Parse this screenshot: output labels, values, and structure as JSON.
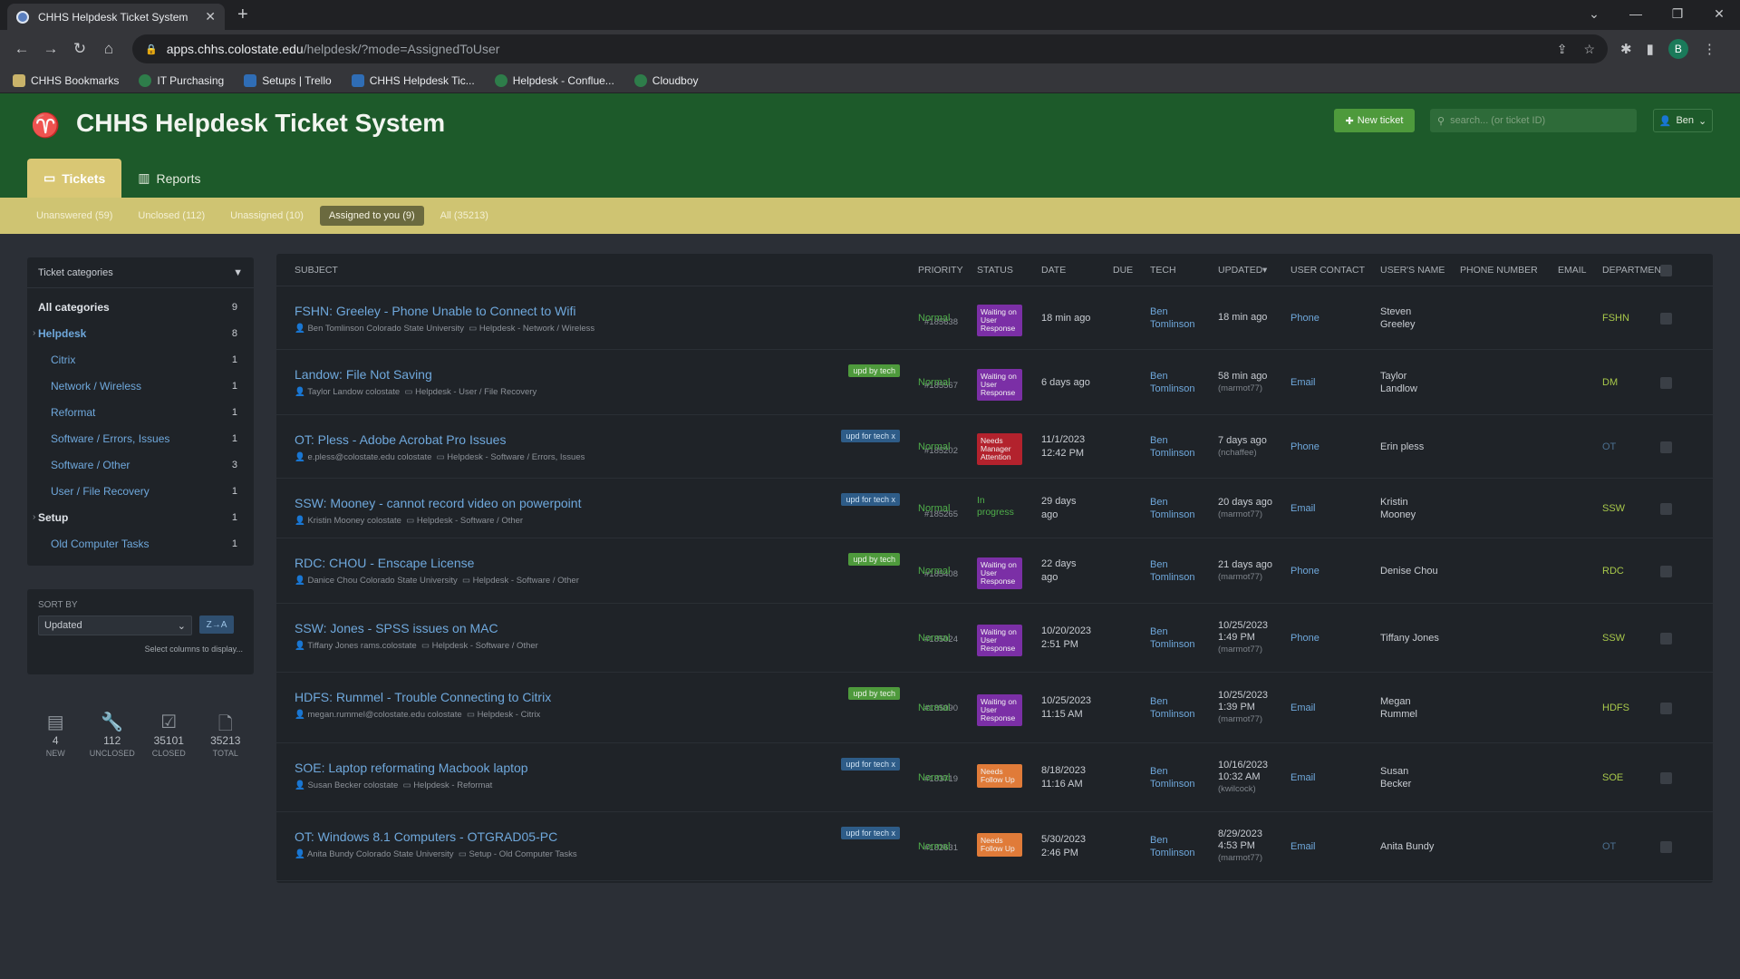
{
  "browser": {
    "tab_title": "CHHS Helpdesk Ticket System",
    "url_host": "apps.chhs.colostate.edu",
    "url_path": "/helpdesk/?mode=AssignedToUser",
    "profile_initial": "B",
    "bookmarks": [
      "CHHS Bookmarks",
      "IT Purchasing",
      "Setups | Trello",
      "CHHS Helpdesk Tic...",
      "Helpdesk - Conflue...",
      "Cloudboy"
    ]
  },
  "header": {
    "title": "CHHS Helpdesk Ticket System",
    "new_ticket": "New ticket",
    "search_placeholder": "search... (or ticket ID)",
    "user": "Ben"
  },
  "nav": {
    "tickets": "Tickets",
    "reports": "Reports"
  },
  "subnav": [
    "Unanswered (59)",
    "Unclosed (112)",
    "Unassigned (10)",
    "Assigned to you (9)",
    "All (35213)"
  ],
  "sidebar": {
    "categories_title": "Ticket categories",
    "categories": [
      {
        "name": "All categories",
        "count": "9"
      },
      {
        "name": "Helpdesk",
        "count": "8"
      },
      {
        "name": "Citrix",
        "count": "1"
      },
      {
        "name": "Network / Wireless",
        "count": "1"
      },
      {
        "name": "Reformat",
        "count": "1"
      },
      {
        "name": "Software / Errors, Issues",
        "count": "1"
      },
      {
        "name": "Software / Other",
        "count": "3"
      },
      {
        "name": "User / File Recovery",
        "count": "1"
      },
      {
        "name": "Setup",
        "count": "1"
      },
      {
        "name": "Old Computer Tasks",
        "count": "1"
      }
    ],
    "sort_label": "SORT BY",
    "sort_value": "Updated",
    "sort_dir": "Z→A",
    "select_columns": "Select columns to display...",
    "stats": [
      {
        "value": "4",
        "label": "NEW"
      },
      {
        "value": "112",
        "label": "UNCLOSED"
      },
      {
        "value": "35101",
        "label": "CLOSED"
      },
      {
        "value": "35213",
        "label": "TOTAL"
      }
    ]
  },
  "table": {
    "headers": [
      "SUBJECT",
      "PRIORITY",
      "STATUS",
      "DATE",
      "DUE",
      "TECH",
      "UPDATED",
      "USER CONTACT",
      "USER'S NAME",
      "PHONE NUMBER",
      "EMAIL",
      "DEPARTMENT"
    ],
    "rows": [
      {
        "subject": "FSHN: Greeley - Phone Unable to Connect to Wifi",
        "user": "Ben Tomlinson Colorado State University",
        "category": "Helpdesk - Network / Wireless",
        "badge": "",
        "number": "#185638",
        "priority": "Normal",
        "status": "Waiting on User Response",
        "date1": "18 min ago",
        "date2": "",
        "tech1": "Ben",
        "tech2": "Tomlinson",
        "upd1": "18 min ago",
        "upd2": "",
        "upd3": "",
        "contact": "Phone",
        "uname1": "Steven",
        "uname2": "Greeley",
        "dept": "FSHN"
      },
      {
        "subject": "Landow: File Not Saving",
        "user": "Taylor Landow colostate",
        "category": "Helpdesk - User / File Recovery",
        "badge": "upd by tech",
        "number": "#185567",
        "priority": "Normal",
        "status": "Waiting on User Response",
        "date1": "6 days ago",
        "date2": "",
        "tech1": "Ben",
        "tech2": "Tomlinson",
        "upd1": "58 min ago",
        "upd2": "",
        "upd3": "(marmot77)",
        "contact": "Email",
        "uname1": "Taylor",
        "uname2": "Landlow",
        "dept": "DM"
      },
      {
        "subject": "OT: Pless - Adobe Acrobat Pro Issues",
        "user": "e.pless@colostate.edu colostate",
        "category": "Helpdesk - Software / Errors, Issues",
        "badge": "upd for tech x",
        "number": "#185202",
        "priority": "Normal",
        "status": "Needs Manager Attention",
        "date1": "11/1/2023",
        "date2": "12:42 PM",
        "tech1": "Ben",
        "tech2": "Tomlinson",
        "upd1": "7 days ago",
        "upd2": "",
        "upd3": "(nchaffee)",
        "contact": "Phone",
        "uname1": "Erin pless",
        "uname2": "",
        "dept": "OT"
      },
      {
        "subject": "SSW: Mooney - cannot record video on powerpoint",
        "user": "Kristin Mooney colostate",
        "category": "Helpdesk - Software / Other",
        "badge": "upd for tech x",
        "number": "#185265",
        "priority": "Normal",
        "status": "In progress",
        "date1": "29 days",
        "date2": "ago",
        "tech1": "Ben",
        "tech2": "Tomlinson",
        "upd1": "20 days ago",
        "upd2": "",
        "upd3": "(marmot77)",
        "contact": "Email",
        "uname1": "Kristin",
        "uname2": "Mooney",
        "dept": "SSW"
      },
      {
        "subject": "RDC: CHOU - Enscape License",
        "user": "Danice Chou Colorado State University",
        "category": "Helpdesk - Software / Other",
        "badge": "upd by tech",
        "number": "#185408",
        "priority": "Normal",
        "status": "Waiting on User Response",
        "date1": "22 days",
        "date2": "ago",
        "tech1": "Ben",
        "tech2": "Tomlinson",
        "upd1": "21 days ago",
        "upd2": "",
        "upd3": "(marmot77)",
        "contact": "Phone",
        "uname1": "Denise Chou",
        "uname2": "",
        "dept": "RDC"
      },
      {
        "subject": "SSW: Jones - SPSS issues on MAC",
        "user": "Tiffany Jones rams.colostate",
        "category": "Helpdesk - Software / Other",
        "badge": "",
        "number": "#185024",
        "priority": "Normal",
        "status": "Waiting on User Response",
        "date1": "10/20/2023",
        "date2": "2:51 PM",
        "tech1": "Ben",
        "tech2": "Tomlinson",
        "upd1": "10/25/2023",
        "upd2": "1:49 PM",
        "upd3": "(marmot77)",
        "contact": "Phone",
        "uname1": "Tiffany Jones",
        "uname2": "",
        "dept": "SSW"
      },
      {
        "subject": "HDFS: Rummel - Trouble Connecting to Citrix",
        "user": "megan.rummel@colostate.edu colostate",
        "category": "Helpdesk - Citrix",
        "badge": "upd by tech",
        "number": "#185090",
        "priority": "Normal",
        "status": "Waiting on User Response",
        "date1": "10/25/2023",
        "date2": "11:15 AM",
        "tech1": "Ben",
        "tech2": "Tomlinson",
        "upd1": "10/25/2023",
        "upd2": "1:39 PM",
        "upd3": "(marmot77)",
        "contact": "Email",
        "uname1": "Megan",
        "uname2": "Rummel",
        "dept": "HDFS"
      },
      {
        "subject": "SOE: Laptop reformating Macbook laptop",
        "user": "Susan Becker colostate",
        "category": "Helpdesk - Reformat",
        "badge": "upd for tech x",
        "number": "#183719",
        "priority": "Normal",
        "status": "Needs Follow Up",
        "date1": "8/18/2023",
        "date2": "11:16 AM",
        "tech1": "Ben",
        "tech2": "Tomlinson",
        "upd1": "10/16/2023",
        "upd2": "10:32 AM",
        "upd3": "(kwilcock)",
        "contact": "Email",
        "uname1": "Susan",
        "uname2": "Becker",
        "dept": "SOE"
      },
      {
        "subject": "OT: Windows 8.1 Computers - OTGRAD05-PC",
        "user": "Anita Bundy Colorado State University",
        "category": "Setup - Old Computer Tasks",
        "badge": "upd for tech x",
        "number": "#182631",
        "priority": "Normal",
        "status": "Needs Follow Up",
        "date1": "5/30/2023",
        "date2": "2:46 PM",
        "tech1": "Ben",
        "tech2": "Tomlinson",
        "upd1": "8/29/2023",
        "upd2": "4:53 PM",
        "upd3": "(marmot77)",
        "contact": "Email",
        "uname1": "Anita Bundy",
        "uname2": "",
        "dept": "OT"
      }
    ]
  },
  "colors": {
    "header_green": "#1d5a2a",
    "subnav_yellow": "#cfc472",
    "link_blue": "#6fa8dc",
    "normal_green": "#4fae4a",
    "status_purple": "#7b2fa6",
    "status_red": "#b3222d",
    "status_orange": "#e07b39"
  }
}
